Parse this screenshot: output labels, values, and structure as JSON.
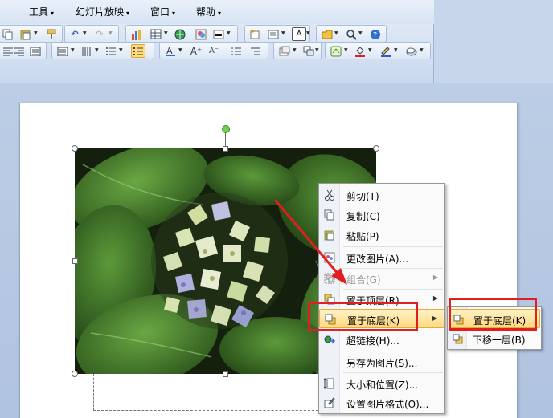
{
  "menubar": {
    "items": [
      {
        "label": "工具"
      },
      {
        "label": "幻灯片放映"
      },
      {
        "label": "窗口"
      },
      {
        "label": "帮助"
      }
    ]
  },
  "icons": {
    "cut": "scissors-icon",
    "copy": "copy-icon",
    "paste": "paste-icon",
    "change_picture": "change-picture-icon",
    "group": "group-icon",
    "bring_to_front": "bring-to-front-icon",
    "send_to_back": "send-to-back-icon",
    "hyperlink": "hyperlink-icon",
    "size_position": "size-position-icon",
    "format_picture": "format-picture-icon",
    "send_backward": "send-backward-icon"
  },
  "context_menu": {
    "items": [
      {
        "label": "剪切(T)"
      },
      {
        "label": "复制(C)"
      },
      {
        "label": "粘贴(P)"
      },
      {
        "label": "更改图片(A)..."
      },
      {
        "label": "组合(G)"
      },
      {
        "label": "置于顶层(R)"
      },
      {
        "label": "置于底层(K)"
      },
      {
        "label": "超链接(H)..."
      },
      {
        "label": "另存为图片(S)..."
      },
      {
        "label": "大小和位置(Z)..."
      },
      {
        "label": "设置图片格式(O)..."
      }
    ]
  },
  "submenu": {
    "items": [
      {
        "label": "置于底层(K)"
      },
      {
        "label": "下移一层(B)"
      }
    ]
  },
  "colors": {
    "highlight": "#ffd97f",
    "annotation_red": "#e02020",
    "ribbon_bg": "#dfe8f5"
  }
}
